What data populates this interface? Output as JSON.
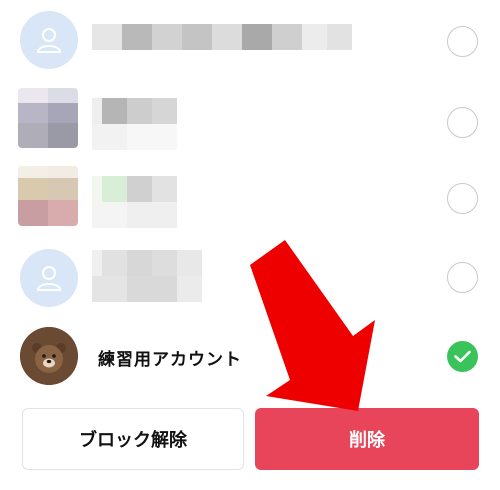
{
  "contacts": [
    {
      "name": "",
      "avatar": "default-person-icon",
      "selected": false
    },
    {
      "name": "",
      "avatar": "pixelated-photo",
      "selected": false
    },
    {
      "name": "",
      "avatar": "pixelated-photo",
      "selected": false
    },
    {
      "name": "",
      "avatar": "default-person-icon",
      "selected": false
    },
    {
      "name": "練習用アカウント",
      "avatar": "brown-bear-icon",
      "selected": true
    }
  ],
  "actions": {
    "unblock_label": "ブロック解除",
    "delete_label": "削除"
  },
  "colors": {
    "delete_bg": "#e8455a",
    "check_green": "#3bc35b",
    "annotation_arrow": "#ee0000"
  }
}
